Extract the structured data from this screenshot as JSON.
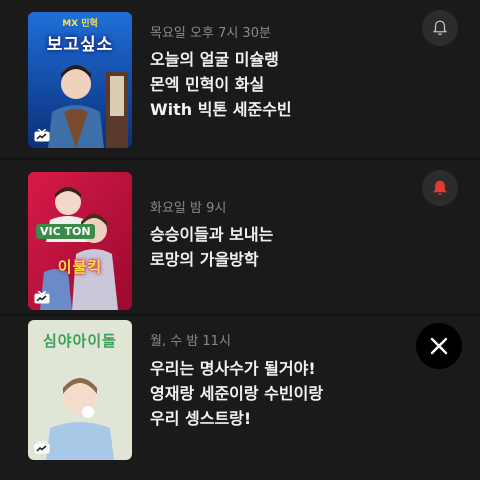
{
  "programs": [
    {
      "thumbnail_title": "보고싶소",
      "thumbnail_subtitle": "MX 민혁",
      "schedule": "목요일 오후 7시 30분",
      "lines": [
        "오늘의 얼굴 미슐랭",
        "몬엑 민혁이 화실",
        "With 빅톤 세준수빈"
      ],
      "alarm_on": false,
      "icon": "bell-icon"
    },
    {
      "thumbnail_title": "이불킥",
      "thumbnail_logo": "VIC TON",
      "schedule": "화요일 밤 9시",
      "lines": [
        "승승이들과 보내는",
        "로망의 가을방학"
      ],
      "alarm_on": true,
      "icon": "bell-icon"
    },
    {
      "thumbnail_title": "심야아이돌",
      "schedule": "월, 수 밤 11시",
      "lines": [
        "우리는 명사수가 될거야!",
        "영재랑 세준이랑 수빈이랑",
        "우리 셍스트랑!"
      ],
      "icon": "close-icon"
    }
  ],
  "colors": {
    "background": "#121212",
    "card": "#1a1a1a",
    "schedule_text": "#8a8a8a",
    "title_text": "#f2f2f2",
    "bell_off": "#bdbdbd",
    "bell_on": "#e53935"
  }
}
